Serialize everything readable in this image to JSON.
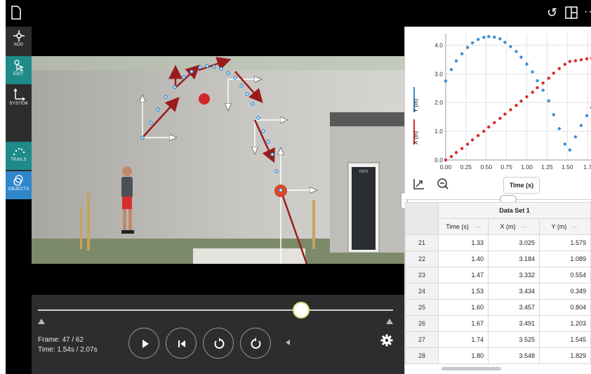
{
  "toolbar": {
    "file_icon": "file-icon",
    "undo_icon": "undo-icon",
    "layout_icon": "layout-icon",
    "more_icon": "more-icon",
    "more_glyph": "··"
  },
  "sidebar": {
    "tools": [
      {
        "label": "ADD",
        "icon": "add-point-icon"
      },
      {
        "label": "EDIT",
        "icon": "edit-pointer-icon"
      },
      {
        "label": "SYSTEM",
        "icon": "axes-icon"
      },
      {
        "label": "TRAILS",
        "icon": "trails-icon"
      },
      {
        "label": "OBJECTS",
        "icon": "objects-icon"
      }
    ]
  },
  "video": {
    "door_sign": "D979",
    "collapse_icon": "minus-circle-icon"
  },
  "playback": {
    "frame_text": "Frame: 47 / 62",
    "time_text": "Time: 1.54s / 2.07s",
    "progress": 0.742,
    "buttons": [
      "play-icon",
      "step-back-icon",
      "rewind-icon",
      "forward-icon"
    ],
    "volume_icon": "volume-icon",
    "settings_icon": "gear-icon"
  },
  "graph": {
    "x_label": "Time (s)",
    "y_label_x": "X (m)",
    "y_label_y": "Y (m)",
    "fit_icon": "axes-fit-icon",
    "zoom_icon": "zoom-out-icon"
  },
  "chart_data": {
    "type": "scatter",
    "xlabel": "Time (s)",
    "ylabel": "X (m) / Y (m)",
    "xlim": [
      0,
      1.8
    ],
    "ylim": [
      0,
      4.4
    ],
    "x_ticks": [
      "0.00",
      "0.25",
      "0.50",
      "0.75",
      "1.00",
      "1.25",
      "1.50",
      "1.7"
    ],
    "y_ticks": [
      "0.0",
      "1.0",
      "2.0",
      "3.0",
      "4.0"
    ],
    "grid": true,
    "series": [
      {
        "name": "Y (m)",
        "color": "#3a8fd8",
        "points": [
          [
            0.0,
            2.75
          ],
          [
            0.07,
            3.15
          ],
          [
            0.13,
            3.45
          ],
          [
            0.2,
            3.7
          ],
          [
            0.27,
            3.92
          ],
          [
            0.33,
            4.08
          ],
          [
            0.4,
            4.2
          ],
          [
            0.47,
            4.27
          ],
          [
            0.53,
            4.3
          ],
          [
            0.6,
            4.28
          ],
          [
            0.67,
            4.22
          ],
          [
            0.73,
            4.1
          ],
          [
            0.8,
            3.95
          ],
          [
            0.87,
            3.78
          ],
          [
            0.93,
            3.58
          ],
          [
            1.0,
            3.34
          ],
          [
            1.07,
            3.07
          ],
          [
            1.13,
            2.76
          ],
          [
            1.2,
            2.43
          ],
          [
            1.27,
            2.06
          ],
          [
            1.33,
            1.579
          ],
          [
            1.4,
            1.089
          ],
          [
            1.47,
            0.554
          ],
          [
            1.53,
            0.349
          ],
          [
            1.6,
            0.804
          ],
          [
            1.67,
            1.203
          ],
          [
            1.74,
            1.545
          ],
          [
            1.8,
            1.829
          ]
        ]
      },
      {
        "name": "X (m)",
        "color": "#d92a2a",
        "points": [
          [
            0.0,
            0.0
          ],
          [
            0.07,
            0.12
          ],
          [
            0.13,
            0.26
          ],
          [
            0.2,
            0.4
          ],
          [
            0.27,
            0.55
          ],
          [
            0.33,
            0.7
          ],
          [
            0.4,
            0.85
          ],
          [
            0.47,
            1.0
          ],
          [
            0.53,
            1.15
          ],
          [
            0.6,
            1.3
          ],
          [
            0.67,
            1.45
          ],
          [
            0.73,
            1.6
          ],
          [
            0.8,
            1.75
          ],
          [
            0.87,
            1.9
          ],
          [
            0.93,
            2.05
          ],
          [
            1.0,
            2.2
          ],
          [
            1.07,
            2.36
          ],
          [
            1.13,
            2.52
          ],
          [
            1.2,
            2.68
          ],
          [
            1.27,
            2.85
          ],
          [
            1.33,
            3.025
          ],
          [
            1.4,
            3.184
          ],
          [
            1.47,
            3.332
          ],
          [
            1.53,
            3.434
          ],
          [
            1.6,
            3.457
          ],
          [
            1.67,
            3.491
          ],
          [
            1.74,
            3.525
          ],
          [
            1.8,
            3.548
          ]
        ]
      }
    ]
  },
  "table": {
    "dataset": "Data Set 1",
    "columns": [
      "Time (s)",
      "X (m)",
      "Y (m)"
    ],
    "col_menu": "···",
    "rows": [
      {
        "n": "21",
        "t": "1.33",
        "x": "3.025",
        "y": "1.579"
      },
      {
        "n": "22",
        "t": "1.40",
        "x": "3.184",
        "y": "1.089"
      },
      {
        "n": "23",
        "t": "1.47",
        "x": "3.332",
        "y": "0.554"
      },
      {
        "n": "24",
        "t": "1.53",
        "x": "3.434",
        "y": "0.349"
      },
      {
        "n": "25",
        "t": "1.60",
        "x": "3.457",
        "y": "0.804"
      },
      {
        "n": "26",
        "t": "1.67",
        "x": "3.491",
        "y": "1.203"
      },
      {
        "n": "27",
        "t": "1.74",
        "x": "3.525",
        "y": "1.545"
      },
      {
        "n": "28",
        "t": "1.80",
        "x": "3.548",
        "y": "1.829"
      }
    ]
  }
}
